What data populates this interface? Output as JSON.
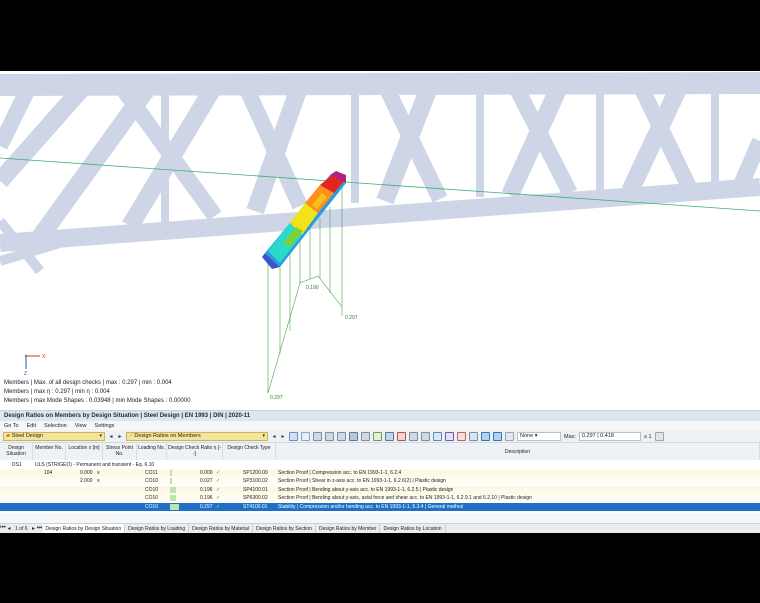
{
  "viewport": {
    "axis": {
      "x": "X",
      "z": "Z"
    },
    "diagram_labels": {
      "mid": "0.190",
      "right": "0.297",
      "bottom": "0.297"
    },
    "info_lines": [
      "Members | Max. of all design checks | max : 0.297 | min : 0.004",
      "Members | max η : 0.297 | min η : 0.004",
      "Members | max Mode Shapes : 0.03948 | min Mode Shapes : 0.00000"
    ]
  },
  "panel": {
    "title": "Design Ratios on Members by Design Situation | Steel Design | EN 1993 | DIN | 2020-11",
    "menu": [
      "Go To",
      "Edit",
      "Selection",
      "View",
      "Settings"
    ],
    "toolbar": {
      "module_combo": "Steel Design",
      "result_combo": "Design Ratios on Members",
      "filter_combo": "None",
      "max_label": "Max:",
      "max_value": "0.297 | 0.418",
      "ratio_value": "≤ 1"
    },
    "columns": [
      "Design Situation",
      "Member No.",
      "Location x [m]",
      "Stress Point No.",
      "Loading No.",
      "Design Check Ratio η [--]",
      "Design Check Type",
      "Description"
    ],
    "group_row": {
      "situation": "DS1",
      "text": "ULS (STR/GEO) - Permanent and transient - Eq. 6.10"
    },
    "rows": [
      {
        "member": "104",
        "location": "0.000",
        "marker": "≡",
        "loading": "CO11",
        "ratio": "0.000",
        "ratio_value": 0.0,
        "type": "SP1200.00",
        "description": "Section Proof | Compression acc. to EN 1993-1-1, 6.2.4",
        "selected": false
      },
      {
        "member": "",
        "location": "2.000",
        "marker": "≡",
        "loading": "CO10",
        "ratio": "0.027",
        "ratio_value": 0.027,
        "type": "SP3100.02",
        "description": "Section Proof | Shear in z-axis acc. to EN 1993-1-1, 6.2.6(2) | Plastic design",
        "selected": false
      },
      {
        "member": "",
        "location": "",
        "marker": "",
        "loading": "CO10",
        "ratio": "0.196",
        "ratio_value": 0.196,
        "type": "SP4100.01",
        "description": "Section Proof | Bending about y-axis acc. to EN 1993-1-1, 6.2.5 | Plastic design",
        "selected": false
      },
      {
        "member": "",
        "location": "",
        "marker": "",
        "loading": "CO10",
        "ratio": "0.196",
        "ratio_value": 0.196,
        "type": "SP6300.02",
        "description": "Section Proof | Bending about y-axis, axial force and shear acc. to EN 1993-1-1, 6.2.9.1 and 6.2.10 | Plastic design",
        "selected": false
      },
      {
        "member": "",
        "location": "",
        "marker": "",
        "loading": "CO10",
        "ratio": "0.297",
        "ratio_value": 0.297,
        "type": "ST4100.01",
        "description": "Stability | Compression and/or bending acc. to EN 1993-1-1, 6.3.4 | General method",
        "selected": true
      }
    ],
    "pager": {
      "current": "1",
      "of_label": "of",
      "total": "6"
    },
    "tabs": [
      "Design Ratios by Design Situation",
      "Design Ratios by Loading",
      "Design Ratios by Material",
      "Design Ratios by Section",
      "Design Ratios by Member",
      "Design Ratios by Location"
    ]
  }
}
